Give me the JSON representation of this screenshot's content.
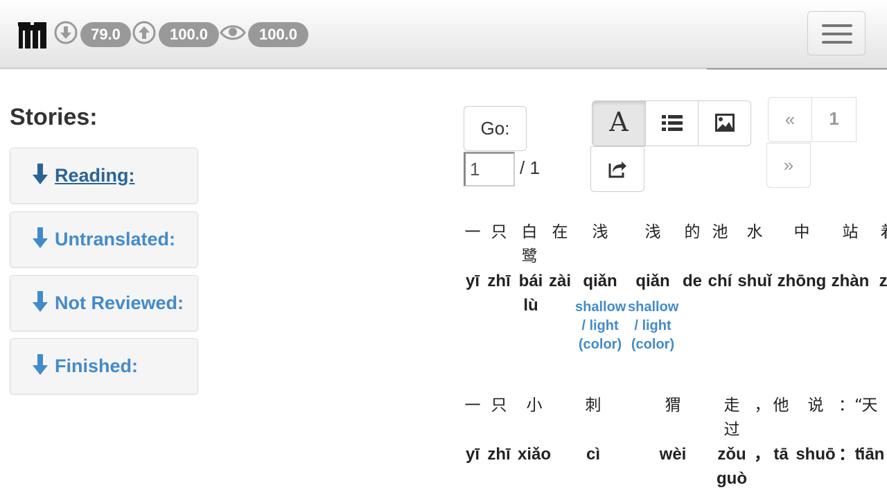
{
  "navbar": {
    "logo_icon": "m-logo-icon",
    "stats": [
      {
        "icon": "download-circle-icon",
        "value": "79.0"
      },
      {
        "icon": "upload-circle-icon",
        "value": "100.0"
      },
      {
        "icon": "eye-icon",
        "value": "100.0"
      }
    ],
    "menu_icon": "hamburger-menu-icon",
    "badge_color": "#999999"
  },
  "sidebar": {
    "heading": "Stories:",
    "items": [
      {
        "label": "Reading:",
        "icon": "arrow-down-icon"
      },
      {
        "label": "Untranslated:",
        "icon": "arrow-down-icon"
      },
      {
        "label": "Not Reviewed:",
        "icon": "arrow-down-icon"
      },
      {
        "label": "Finished:",
        "icon": "arrow-down-icon"
      }
    ],
    "link_color": "#428bca"
  },
  "toolbar": {
    "go_label": "Go:",
    "page_value": "1",
    "page_total": "/ 1",
    "modes": [
      {
        "icon": "text-font-icon",
        "label": "A",
        "active": true
      },
      {
        "icon": "list-icon",
        "active": false
      },
      {
        "icon": "image-icon",
        "active": false
      }
    ],
    "share_icon": "share-icon",
    "pager": {
      "prev": "«",
      "page": "1",
      "next": "»"
    }
  },
  "reading": {
    "lines": [
      {
        "words": [
          {
            "hanzi": "一",
            "pinyin": "yī",
            "trans": ""
          },
          {
            "hanzi": "只",
            "pinyin": "zhī",
            "trans": ""
          },
          {
            "hanzi": "白鹭",
            "pinyin": "bái lù",
            "trans": ""
          },
          {
            "hanzi": "在",
            "pinyin": "zài",
            "trans": ""
          },
          {
            "hanzi": "浅",
            "pinyin": "qiǎn",
            "trans": "shallow / light (color)"
          },
          {
            "hanzi": "浅",
            "pinyin": "qiǎn",
            "trans": "shallow / light (color)"
          },
          {
            "hanzi": "的",
            "pinyin": "de",
            "trans": ""
          },
          {
            "hanzi": "池",
            "pinyin": "chí",
            "trans": ""
          },
          {
            "hanzi": "水",
            "pinyin": "shuǐ",
            "trans": ""
          },
          {
            "hanzi": "中",
            "pinyin": "zhōng",
            "trans": ""
          },
          {
            "hanzi": "站",
            "pinyin": "zhàn",
            "trans": ""
          },
          {
            "hanzi": "着",
            "pinyin": "zh",
            "trans": ""
          }
        ]
      },
      {
        "words": [
          {
            "hanzi": "一",
            "pinyin": "yī",
            "trans": ""
          },
          {
            "hanzi": "只",
            "pinyin": "zhī",
            "trans": ""
          },
          {
            "hanzi": "小",
            "pinyin": "xiǎo",
            "trans": ""
          },
          {
            "hanzi": "刺",
            "pinyin": "cì",
            "trans": ""
          },
          {
            "hanzi": "猬",
            "pinyin": "wèi",
            "trans": ""
          },
          {
            "hanzi": "走过",
            "pinyin": "zǒu guò",
            "trans": ""
          },
          {
            "hanzi": "，",
            "pinyin": "，",
            "trans": ""
          },
          {
            "hanzi": "他",
            "pinyin": "tā",
            "trans": ""
          },
          {
            "hanzi": "说",
            "pinyin": "shuō",
            "trans": ""
          },
          {
            "hanzi": "：“",
            "pinyin": "：“",
            "trans": ""
          },
          {
            "hanzi": "天",
            "pinyin": "tiān",
            "trans": ""
          }
        ]
      }
    ]
  }
}
